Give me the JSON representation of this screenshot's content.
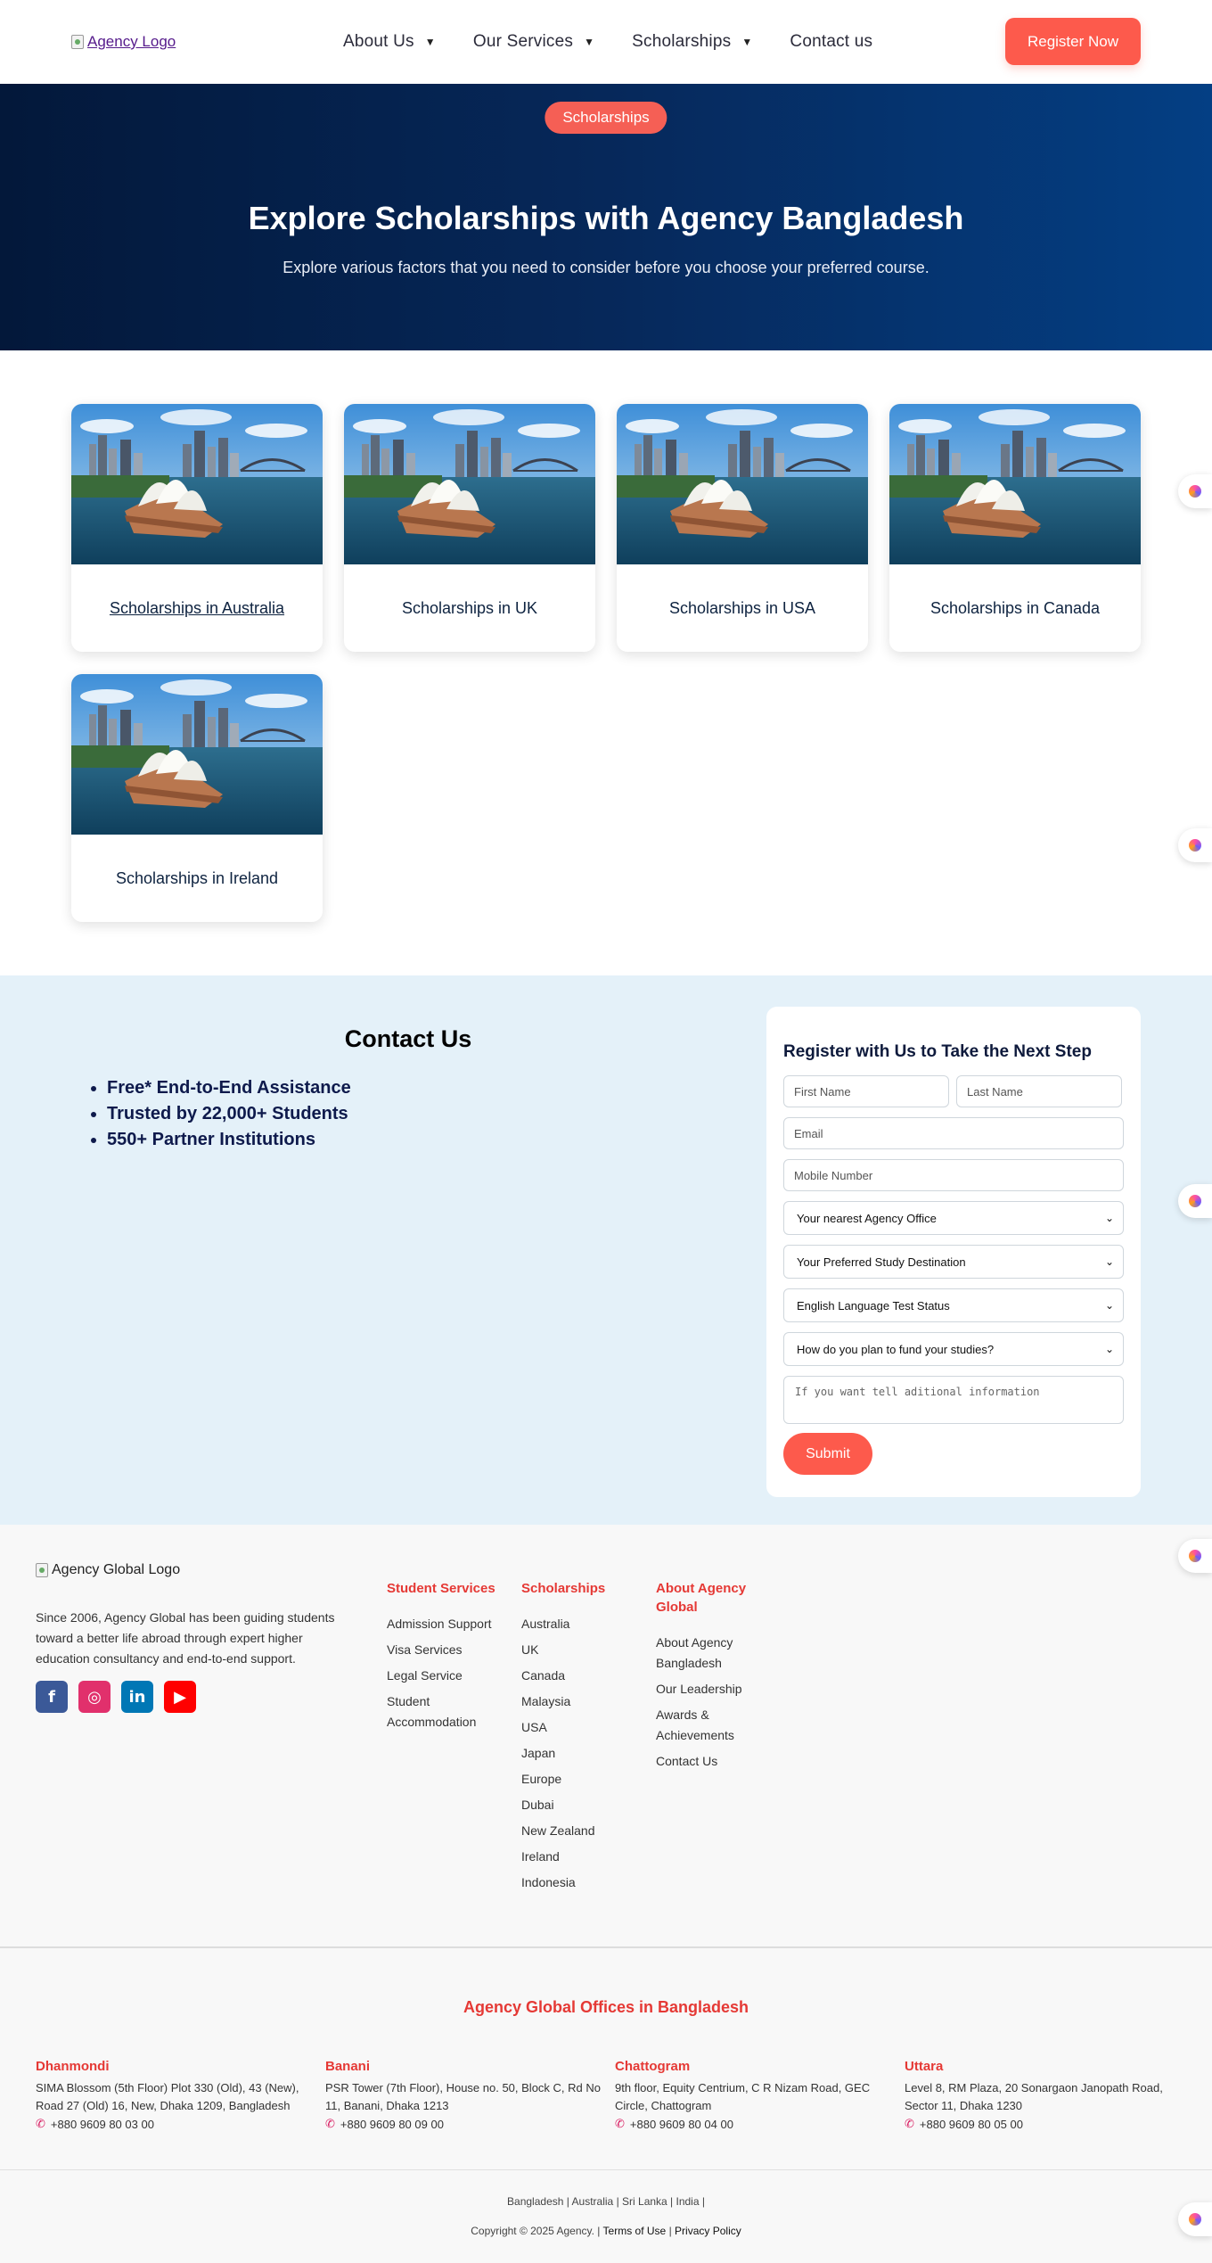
{
  "header": {
    "logo_alt": "Agency Logo",
    "nav": [
      {
        "label": "About Us",
        "has_dropdown": true
      },
      {
        "label": "Our Services",
        "has_dropdown": true
      },
      {
        "label": "Scholarships",
        "has_dropdown": true
      },
      {
        "label": "Contact us",
        "has_dropdown": false
      }
    ],
    "register_label": "Register Now"
  },
  "hero": {
    "badge": "Scholarships",
    "title": "Explore Scholarships with Agency Bangladesh",
    "subtitle": "Explore various factors that you need to consider before you choose your preferred course."
  },
  "cards": [
    {
      "title": "Scholarships in Australia"
    },
    {
      "title": "Scholarships in UK"
    },
    {
      "title": "Scholarships in USA"
    },
    {
      "title": "Scholarships in Canada"
    },
    {
      "title": "Scholarships in Ireland"
    }
  ],
  "contact": {
    "heading": "Contact Us",
    "points": [
      "Free* End-to-End Assistance",
      "Trusted by 22,000+ Students",
      "550+ Partner Institutions"
    ]
  },
  "form": {
    "title": "Register with Us to Take the Next Step",
    "first_name_placeholder": "First Name",
    "last_name_placeholder": "Last Name",
    "email_placeholder": "Email",
    "mobile_placeholder": "Mobile Number",
    "selects": [
      "Your nearest Agency Office",
      "Your Preferred Study Destination",
      "English Language Test Status",
      "How do you plan to fund your studies?"
    ],
    "textarea_placeholder": "If you want tell aditional information",
    "submit_label": "Submit"
  },
  "footer": {
    "logo_alt": "Agency Global Logo",
    "about": "Since 2006, Agency Global has been guiding students toward a better life abroad through expert higher education consultancy and end-to-end support.",
    "social": [
      "facebook-icon",
      "instagram-icon",
      "linkedin-icon",
      "youtube-icon"
    ],
    "columns": [
      {
        "heading": "Student Services",
        "items": [
          "Admission Support",
          "Visa Services",
          "Legal Service",
          "Student Accommodation"
        ]
      },
      {
        "heading": "Scholarships",
        "items": [
          "Australia",
          "UK",
          "Canada",
          "Malaysia",
          "USA",
          "Japan",
          "Europe",
          "Dubai",
          "New Zealand",
          "Ireland",
          "Indonesia"
        ]
      },
      {
        "heading": "About Agency Global",
        "items": [
          "About Agency Bangladesh",
          "Our Leadership",
          "Awards & Achievements",
          "Contact Us"
        ]
      }
    ]
  },
  "offices": {
    "title": "Agency Global Offices in Bangladesh",
    "list": [
      {
        "name": "Dhanmondi",
        "address": "SIMA Blossom (5th Floor) Plot 330 (Old), 43 (New), Road 27 (Old) 16, New, Dhaka 1209, Bangladesh",
        "phone": "+880 9609 80 03 00"
      },
      {
        "name": "Banani",
        "address": "PSR Tower (7th Floor), House no. 50, Block C, Rd No 11, Banani, Dhaka 1213",
        "phone": "+880 9609 80 09 00"
      },
      {
        "name": "Chattogram",
        "address": "9th floor, Equity Centrium, C R Nizam Road, GEC Circle, Chattogram",
        "phone": "+880 9609 80 04 00"
      },
      {
        "name": "Uttara",
        "address": "Level 8, RM Plaza, 20 Sonargaon Janopath Road, Sector 11, Dhaka 1230",
        "phone": "+880 9609 80 05 00"
      }
    ]
  },
  "bottom": {
    "countries": "Bangladesh | Australia | Sri Lanka | India |",
    "copyright": "Copyright © 2025 Agency. |",
    "terms": "Terms of Use",
    "separator": "|",
    "privacy": "Privacy Policy"
  },
  "colors": {
    "accent": "#fd5a4c",
    "hero_dark": "#03183a",
    "hero_light": "#043f84",
    "footer_heading": "#e53935",
    "contact_bg": "#e4f1f9"
  }
}
